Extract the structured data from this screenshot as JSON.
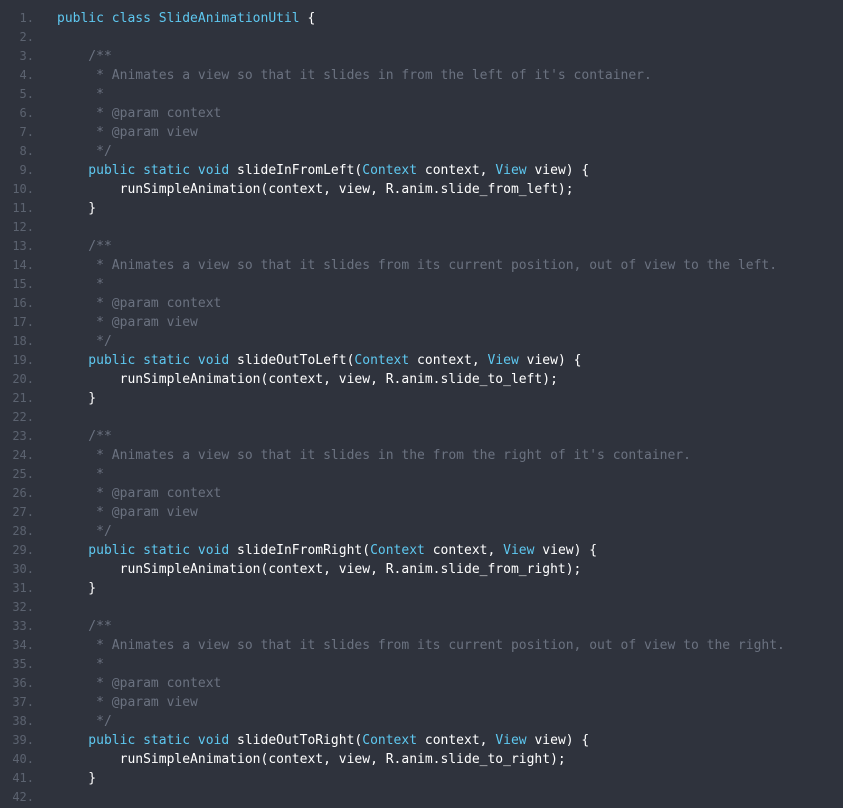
{
  "editor": {
    "lines": [
      {
        "n": "1.",
        "segs": [
          {
            "t": "public class ",
            "c": "kw"
          },
          {
            "t": "SlideAnimationUtil",
            "c": "ty"
          },
          {
            "t": " {",
            "c": ""
          }
        ]
      },
      {
        "n": "2.",
        "segs": []
      },
      {
        "n": "3.",
        "segs": [
          {
            "t": "    /**",
            "c": "cm"
          }
        ]
      },
      {
        "n": "4.",
        "segs": [
          {
            "t": "     * Animates a view so that it slides in from the left of it's container.",
            "c": "cm"
          }
        ]
      },
      {
        "n": "5.",
        "segs": [
          {
            "t": "     *",
            "c": "cm"
          }
        ]
      },
      {
        "n": "6.",
        "segs": [
          {
            "t": "     * @param context",
            "c": "cm"
          }
        ]
      },
      {
        "n": "7.",
        "segs": [
          {
            "t": "     * @param view",
            "c": "cm"
          }
        ]
      },
      {
        "n": "8.",
        "segs": [
          {
            "t": "     */",
            "c": "cm"
          }
        ]
      },
      {
        "n": "9.",
        "segs": [
          {
            "t": "    public static void ",
            "c": "kw"
          },
          {
            "t": "slideInFromLeft(",
            "c": ""
          },
          {
            "t": "Context",
            "c": "ty"
          },
          {
            "t": " context, ",
            "c": ""
          },
          {
            "t": "View",
            "c": "ty"
          },
          {
            "t": " view) {",
            "c": ""
          }
        ]
      },
      {
        "n": "10.",
        "segs": [
          {
            "t": "        runSimpleAnimation(context, view, R.anim.slide_from_left);",
            "c": ""
          }
        ]
      },
      {
        "n": "11.",
        "segs": [
          {
            "t": "    }",
            "c": ""
          }
        ]
      },
      {
        "n": "12.",
        "segs": []
      },
      {
        "n": "13.",
        "segs": [
          {
            "t": "    /**",
            "c": "cm"
          }
        ]
      },
      {
        "n": "14.",
        "segs": [
          {
            "t": "     * Animates a view so that it slides from its current position, out of view to the left.",
            "c": "cm"
          }
        ]
      },
      {
        "n": "15.",
        "segs": [
          {
            "t": "     *",
            "c": "cm"
          }
        ]
      },
      {
        "n": "16.",
        "segs": [
          {
            "t": "     * @param context",
            "c": "cm"
          }
        ]
      },
      {
        "n": "17.",
        "segs": [
          {
            "t": "     * @param view",
            "c": "cm"
          }
        ]
      },
      {
        "n": "18.",
        "segs": [
          {
            "t": "     */",
            "c": "cm"
          }
        ]
      },
      {
        "n": "19.",
        "segs": [
          {
            "t": "    public static void ",
            "c": "kw"
          },
          {
            "t": "slideOutToLeft(",
            "c": ""
          },
          {
            "t": "Context",
            "c": "ty"
          },
          {
            "t": " context, ",
            "c": ""
          },
          {
            "t": "View",
            "c": "ty"
          },
          {
            "t": " view) {",
            "c": ""
          }
        ]
      },
      {
        "n": "20.",
        "segs": [
          {
            "t": "        runSimpleAnimation(context, view, R.anim.slide_to_left);",
            "c": ""
          }
        ]
      },
      {
        "n": "21.",
        "segs": [
          {
            "t": "    }",
            "c": ""
          }
        ]
      },
      {
        "n": "22.",
        "segs": []
      },
      {
        "n": "23.",
        "segs": [
          {
            "t": "    /**",
            "c": "cm"
          }
        ]
      },
      {
        "n": "24.",
        "segs": [
          {
            "t": "     * Animates a view so that it slides in the from the right of it's container.",
            "c": "cm"
          }
        ]
      },
      {
        "n": "25.",
        "segs": [
          {
            "t": "     *",
            "c": "cm"
          }
        ]
      },
      {
        "n": "26.",
        "segs": [
          {
            "t": "     * @param context",
            "c": "cm"
          }
        ]
      },
      {
        "n": "27.",
        "segs": [
          {
            "t": "     * @param view",
            "c": "cm"
          }
        ]
      },
      {
        "n": "28.",
        "segs": [
          {
            "t": "     */",
            "c": "cm"
          }
        ]
      },
      {
        "n": "29.",
        "segs": [
          {
            "t": "    public static void ",
            "c": "kw"
          },
          {
            "t": "slideInFromRight(",
            "c": ""
          },
          {
            "t": "Context",
            "c": "ty"
          },
          {
            "t": " context, ",
            "c": ""
          },
          {
            "t": "View",
            "c": "ty"
          },
          {
            "t": " view) {",
            "c": ""
          }
        ]
      },
      {
        "n": "30.",
        "segs": [
          {
            "t": "        runSimpleAnimation(context, view, R.anim.slide_from_right);",
            "c": ""
          }
        ]
      },
      {
        "n": "31.",
        "segs": [
          {
            "t": "    }",
            "c": ""
          }
        ]
      },
      {
        "n": "32.",
        "segs": []
      },
      {
        "n": "33.",
        "segs": [
          {
            "t": "    /**",
            "c": "cm"
          }
        ]
      },
      {
        "n": "34.",
        "segs": [
          {
            "t": "     * Animates a view so that it slides from its current position, out of view to the right.",
            "c": "cm"
          }
        ]
      },
      {
        "n": "35.",
        "segs": [
          {
            "t": "     *",
            "c": "cm"
          }
        ]
      },
      {
        "n": "36.",
        "segs": [
          {
            "t": "     * @param context",
            "c": "cm"
          }
        ]
      },
      {
        "n": "37.",
        "segs": [
          {
            "t": "     * @param view",
            "c": "cm"
          }
        ]
      },
      {
        "n": "38.",
        "segs": [
          {
            "t": "     */",
            "c": "cm"
          }
        ]
      },
      {
        "n": "39.",
        "segs": [
          {
            "t": "    public static void ",
            "c": "kw"
          },
          {
            "t": "slideOutToRight(",
            "c": ""
          },
          {
            "t": "Context",
            "c": "ty"
          },
          {
            "t": " context, ",
            "c": ""
          },
          {
            "t": "View",
            "c": "ty"
          },
          {
            "t": " view) {",
            "c": ""
          }
        ]
      },
      {
        "n": "40.",
        "segs": [
          {
            "t": "        runSimpleAnimation(context, view, R.anim.slide_to_right);",
            "c": ""
          }
        ]
      },
      {
        "n": "41.",
        "segs": [
          {
            "t": "    }",
            "c": ""
          }
        ]
      },
      {
        "n": "42.",
        "segs": []
      }
    ]
  },
  "colors": {
    "background": "#2f333d",
    "keyword": "#5ec8f0",
    "comment": "#6b7280",
    "text": "#ffffff",
    "line_number": "#5c6370"
  }
}
